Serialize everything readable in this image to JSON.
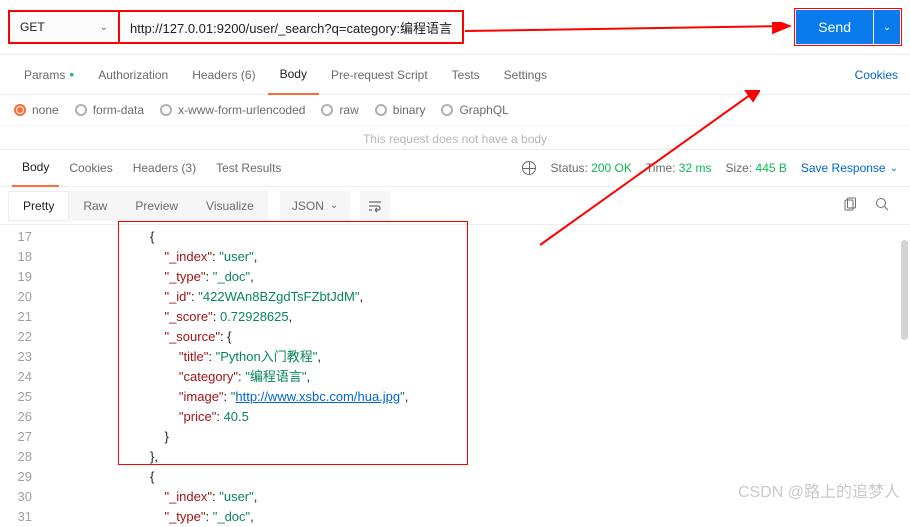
{
  "request": {
    "method": "GET",
    "url": "http://127.0.01:9200/user/_search?q=category:编程语言",
    "send_label": "Send"
  },
  "req_tabs": {
    "params": "Params",
    "authorization": "Authorization",
    "headers": "Headers (6)",
    "body": "Body",
    "prerequest": "Pre-request Script",
    "tests": "Tests",
    "settings": "Settings",
    "cookies": "Cookies"
  },
  "body_types": {
    "none": "none",
    "formdata": "form-data",
    "xwww": "x-www-form-urlencoded",
    "raw": "raw",
    "binary": "binary",
    "graphql": "GraphQL"
  },
  "no_body_msg": "This request does not have a body",
  "resp_tabs": {
    "body": "Body",
    "cookies": "Cookies",
    "headers": "Headers (3)",
    "test_results": "Test Results"
  },
  "resp_meta": {
    "status_label": "Status:",
    "status_value": "200 OK",
    "time_label": "Time:",
    "time_value": "32 ms",
    "size_label": "Size:",
    "size_value": "445 B",
    "save": "Save Response"
  },
  "view": {
    "pretty": "Pretty",
    "raw": "Raw",
    "preview": "Preview",
    "visualize": "Visualize",
    "format": "JSON"
  },
  "code": {
    "lines": [
      17,
      18,
      19,
      20,
      21,
      22,
      23,
      24,
      25,
      26,
      27,
      28,
      29,
      30,
      31
    ],
    "kv": {
      "index": "\"_index\"",
      "index_v": "\"user\"",
      "type": "\"_type\"",
      "type_v": "\"_doc\"",
      "id": "\"_id\"",
      "id_v": "\"422WAn8BZgdTsFZbtJdM\"",
      "score": "\"_score\"",
      "score_v": "0.72928625",
      "source": "\"_source\"",
      "title": "\"title\"",
      "title_v": "\"Python入门教程\"",
      "category": "\"category\"",
      "category_v": "\"编程语言\"",
      "image": "\"image\"",
      "image_v": "\"http://www.xsbc.com/hua.jpg\"",
      "price": "\"price\"",
      "price_v": "40.5"
    }
  },
  "watermark": "CSDN @路上的追梦人"
}
